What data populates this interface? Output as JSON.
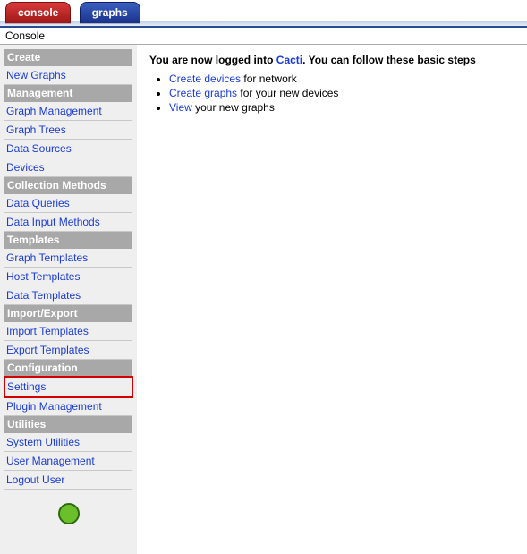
{
  "tabs": {
    "console": "console",
    "graphs": "graphs"
  },
  "subheader": "Console",
  "sidebar": {
    "sections": [
      {
        "title": "Create",
        "items": [
          "New Graphs"
        ]
      },
      {
        "title": "Management",
        "items": [
          "Graph Management",
          "Graph Trees",
          "Data Sources",
          "Devices"
        ]
      },
      {
        "title": "Collection Methods",
        "items": [
          "Data Queries",
          "Data Input Methods"
        ]
      },
      {
        "title": "Templates",
        "items": [
          "Graph Templates",
          "Host Templates",
          "Data Templates"
        ]
      },
      {
        "title": "Import/Export",
        "items": [
          "Import Templates",
          "Export Templates"
        ]
      },
      {
        "title": "Configuration",
        "items": [
          "Settings",
          "Plugin Management"
        ],
        "highlight_index": 0
      },
      {
        "title": "Utilities",
        "items": [
          "System Utilities",
          "User Management",
          "Logout User"
        ]
      }
    ]
  },
  "main": {
    "intro_prefix": "You are now logged into ",
    "brand": "Cacti",
    "intro_suffix": ". You can follow these basic steps ",
    "steps": [
      {
        "link": "Create devices",
        "rest": " for network"
      },
      {
        "link": "Create graphs",
        "rest": " for your new devices"
      },
      {
        "link": "View",
        "rest": " your new graphs"
      }
    ]
  }
}
